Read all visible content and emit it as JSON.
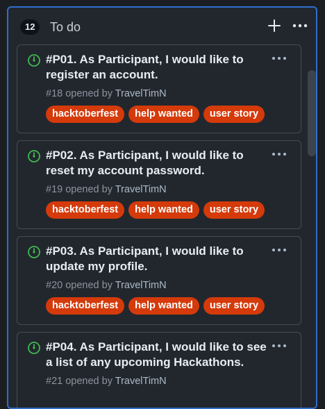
{
  "column": {
    "count": "12",
    "title": "To do",
    "add_icon": "plus-icon",
    "menu_icon": "kebab-horizontal-icon"
  },
  "cards": [
    {
      "title": "#P01. As Participant, I would like to register an account.",
      "number": "#18",
      "opened_by_text": "opened by",
      "author": "TravelTimN",
      "labels": [
        "hacktoberfest",
        "help wanted",
        "user story"
      ]
    },
    {
      "title": "#P02. As Participant, I would like to reset my account password.",
      "number": "#19",
      "opened_by_text": "opened by",
      "author": "TravelTimN",
      "labels": [
        "hacktoberfest",
        "help wanted",
        "user story"
      ]
    },
    {
      "title": "#P03. As Participant, I would like to update my profile.",
      "number": "#20",
      "opened_by_text": "opened by",
      "author": "TravelTimN",
      "labels": [
        "hacktoberfest",
        "help wanted",
        "user story"
      ]
    },
    {
      "title": "#P04. As Participant, I would like to see a list of any upcoming Hackathons.",
      "number": "#21",
      "opened_by_text": "opened by",
      "author": "TravelTimN",
      "labels": []
    }
  ],
  "colors": {
    "accent_border": "#316dca",
    "label_bg": "#d53a0a",
    "open_issue_green": "#3fb950"
  },
  "icons": {
    "status": "issue-opened-icon",
    "card_menu": "kebab-horizontal-icon"
  }
}
